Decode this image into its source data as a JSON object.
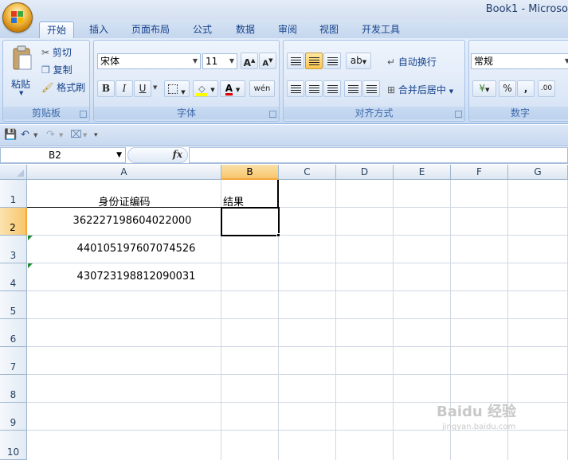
{
  "window": {
    "title": "Book1 - Microso"
  },
  "tabs": [
    {
      "label": "开始",
      "active": true
    },
    {
      "label": "插入"
    },
    {
      "label": "页面布局"
    },
    {
      "label": "公式"
    },
    {
      "label": "数据"
    },
    {
      "label": "审阅"
    },
    {
      "label": "视图"
    },
    {
      "label": "开发工具"
    }
  ],
  "ribbon": {
    "clipboard": {
      "label": "剪贴板",
      "paste": "粘贴",
      "cut": "剪切",
      "copy": "复制",
      "format_painter": "格式刷"
    },
    "font": {
      "label": "字体",
      "font_name": "宋体",
      "font_size": "11",
      "bold": "B",
      "italic": "I",
      "underline": "U"
    },
    "alignment": {
      "label": "对齐方式",
      "wrap_text": "自动换行",
      "merge_center": "合并后居中"
    },
    "number": {
      "label": "数字",
      "format": "常规",
      "percent": "%",
      "comma": ","
    }
  },
  "formula_bar": {
    "name_box": "B2",
    "fx": "fx",
    "value": ""
  },
  "grid": {
    "columns": [
      "A",
      "B",
      "C",
      "D",
      "E",
      "F",
      "G"
    ],
    "rows": [
      "1",
      "2",
      "3",
      "4",
      "5",
      "6",
      "7",
      "8",
      "9",
      "10"
    ],
    "selected_cell": "B2",
    "cells": {
      "A1": "身份证编码",
      "B1": "结果",
      "A2": "362227198604022000",
      "A3": "440105197607074526",
      "A4": "430723198812090031"
    }
  },
  "watermark": {
    "text": "Baidu 经验",
    "url": "jingyan.baidu.com"
  },
  "colors": {
    "ribbon": "#dce7f6",
    "selected_header": "#f8c66c",
    "error_triangle": "#1e8a2e"
  }
}
